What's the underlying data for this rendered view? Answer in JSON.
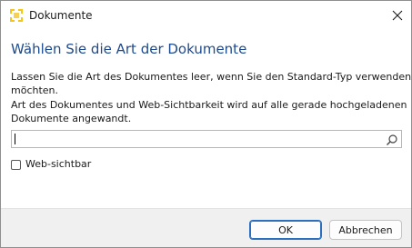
{
  "window": {
    "title": "Dokumente",
    "icon": "app-logo-icon",
    "close_icon": "close-icon"
  },
  "dialog": {
    "heading": "Wählen Sie die Art der Dokumente",
    "description_lines": [
      "Lassen Sie die Art des Dokumentes leer, wenn Sie den Standard-Typ verwenden",
      "möchten.",
      "Art des Dokumentes und Web-Sichtbarkeit wird auf alle gerade hochgeladenen",
      "Dokumente angewandt."
    ],
    "search": {
      "value": "",
      "placeholder": "",
      "icon": "search-icon"
    },
    "web_visible": {
      "label": "Web-sichtbar",
      "checked": false
    }
  },
  "footer": {
    "ok_label": "OK",
    "cancel_label": "Abbrechen"
  },
  "colors": {
    "heading": "#1d4a8f",
    "icon_yellow": "#f5c518",
    "default_button_border": "#2c6fbf",
    "footer_bg": "#f0f0f0"
  }
}
